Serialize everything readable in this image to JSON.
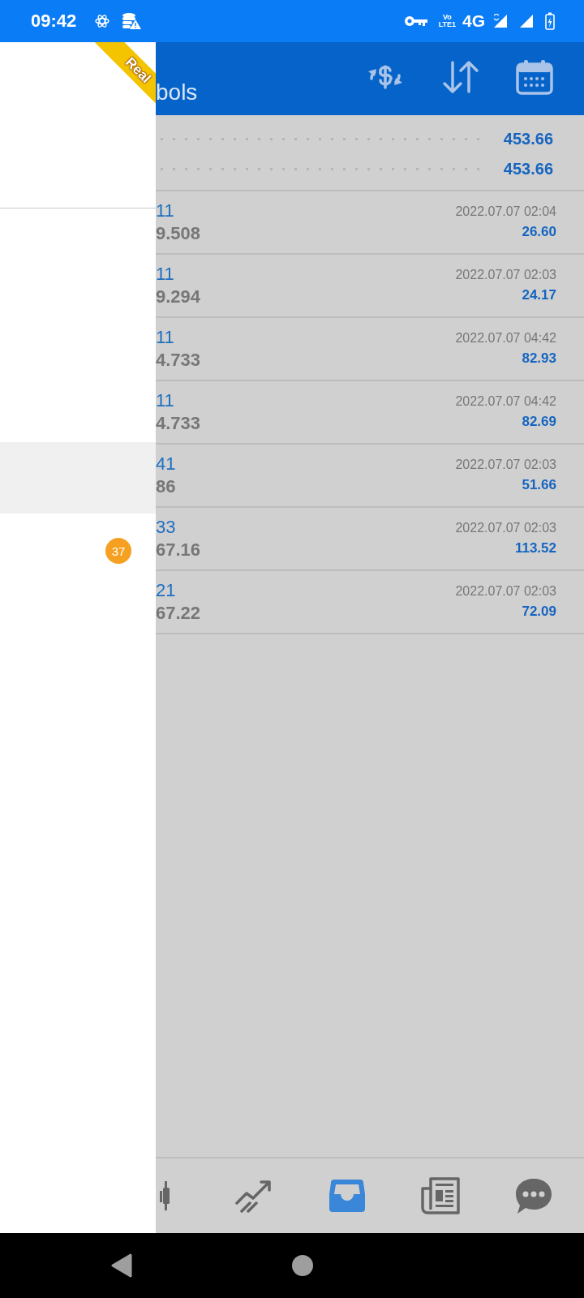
{
  "status_bar": {
    "time": "09:42",
    "volte": [
      "Vo",
      "LTE1"
    ],
    "network": "4G"
  },
  "drawer": {
    "ribbon": "Real",
    "items": [
      {
        "selected": false
      },
      {
        "selected": false
      },
      {
        "selected": false
      },
      {
        "selected": true
      },
      {
        "selected": false,
        "badge": "37"
      }
    ]
  },
  "header": {
    "title": "bols"
  },
  "summary": [
    "453.66",
    "453.66"
  ],
  "deals": [
    {
      "symbol": "11",
      "price": "9.508",
      "time": "2022.07.07 02:04",
      "profit": "26.60"
    },
    {
      "symbol": "11",
      "price": "9.294",
      "time": "2022.07.07 02:03",
      "profit": "24.17"
    },
    {
      "symbol": "11",
      "price": "4.733",
      "time": "2022.07.07 04:42",
      "profit": "82.93"
    },
    {
      "symbol": "11",
      "price": "4.733",
      "time": "2022.07.07 04:42",
      "profit": "82.69"
    },
    {
      "symbol": "41",
      "price": "86",
      "time": "2022.07.07 02:03",
      "profit": "51.66"
    },
    {
      "symbol": "33",
      "price": "67.16",
      "time": "2022.07.07 02:03",
      "profit": "113.52"
    },
    {
      "symbol": "21",
      "price": "67.22",
      "time": "2022.07.07 02:03",
      "profit": "72.09"
    }
  ],
  "bottom_nav": [
    {
      "kind": "chart",
      "selected": false
    },
    {
      "kind": "trade",
      "selected": false
    },
    {
      "kind": "history",
      "selected": true
    },
    {
      "kind": "news",
      "selected": false
    },
    {
      "kind": "chat",
      "selected": false
    }
  ]
}
